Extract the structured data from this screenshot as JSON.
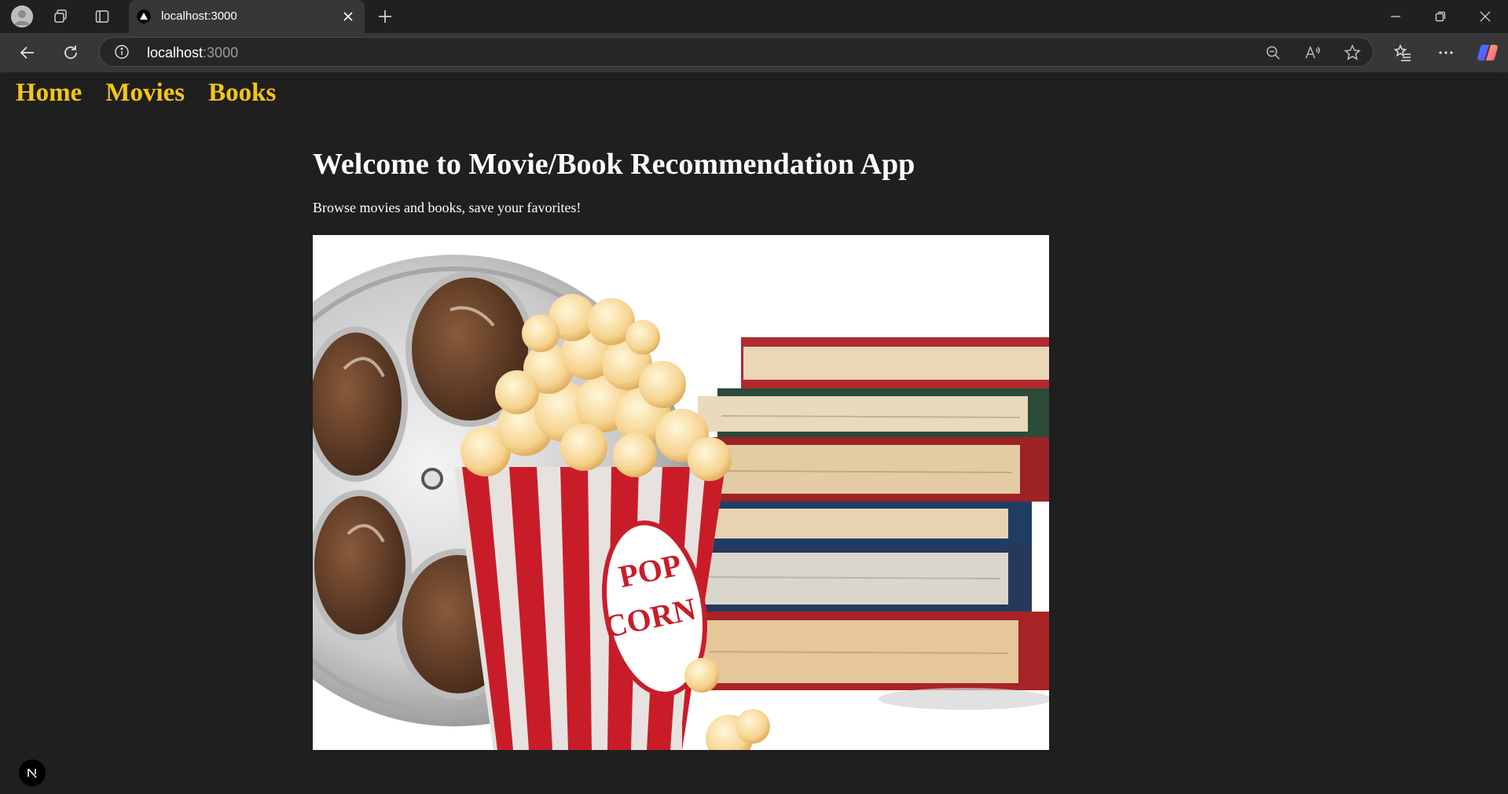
{
  "browser": {
    "tab": {
      "title": "localhost:3000"
    },
    "address_bar": {
      "host": "localhost",
      "port": ":3000"
    },
    "icons": {
      "profile": "profile-avatar-icon",
      "workspaces": "workspaces-icon",
      "tab_actions": "vertical-tabs-icon",
      "tab_favicon": "triangle-favicon-icon",
      "tab_close": "close-icon",
      "new_tab": "plus-icon",
      "minimize": "minimize-icon",
      "restore": "restore-icon",
      "close_window": "close-icon",
      "back": "arrow-left-icon",
      "refresh": "refresh-icon",
      "site_info": "info-icon",
      "zoom": "zoom-out-icon",
      "read_aloud": "read-aloud-icon",
      "favorite": "star-icon",
      "favorites_hub": "favorites-list-icon",
      "more": "ellipsis-icon",
      "copilot": "copilot-icon"
    }
  },
  "page": {
    "nav": {
      "items": [
        {
          "label": "Home"
        },
        {
          "label": "Movies"
        },
        {
          "label": "Books"
        }
      ]
    },
    "title": "Welcome to Movie/Book Recommendation App",
    "subtitle": "Browse movies and books, save your favorites!",
    "hero_image": {
      "depicts": [
        "film-reel",
        "popcorn-bucket",
        "book-stack"
      ],
      "popcorn_text_line1": "POP",
      "popcorn_text_line2": "CORN"
    },
    "dev_badge": {
      "letter": "N"
    }
  },
  "colors": {
    "nav_link": "#f5c518",
    "page_background": "#1f1f1f",
    "title_text": "#ffffff",
    "chrome_background": "#202020",
    "toolbar_background": "#373737"
  }
}
